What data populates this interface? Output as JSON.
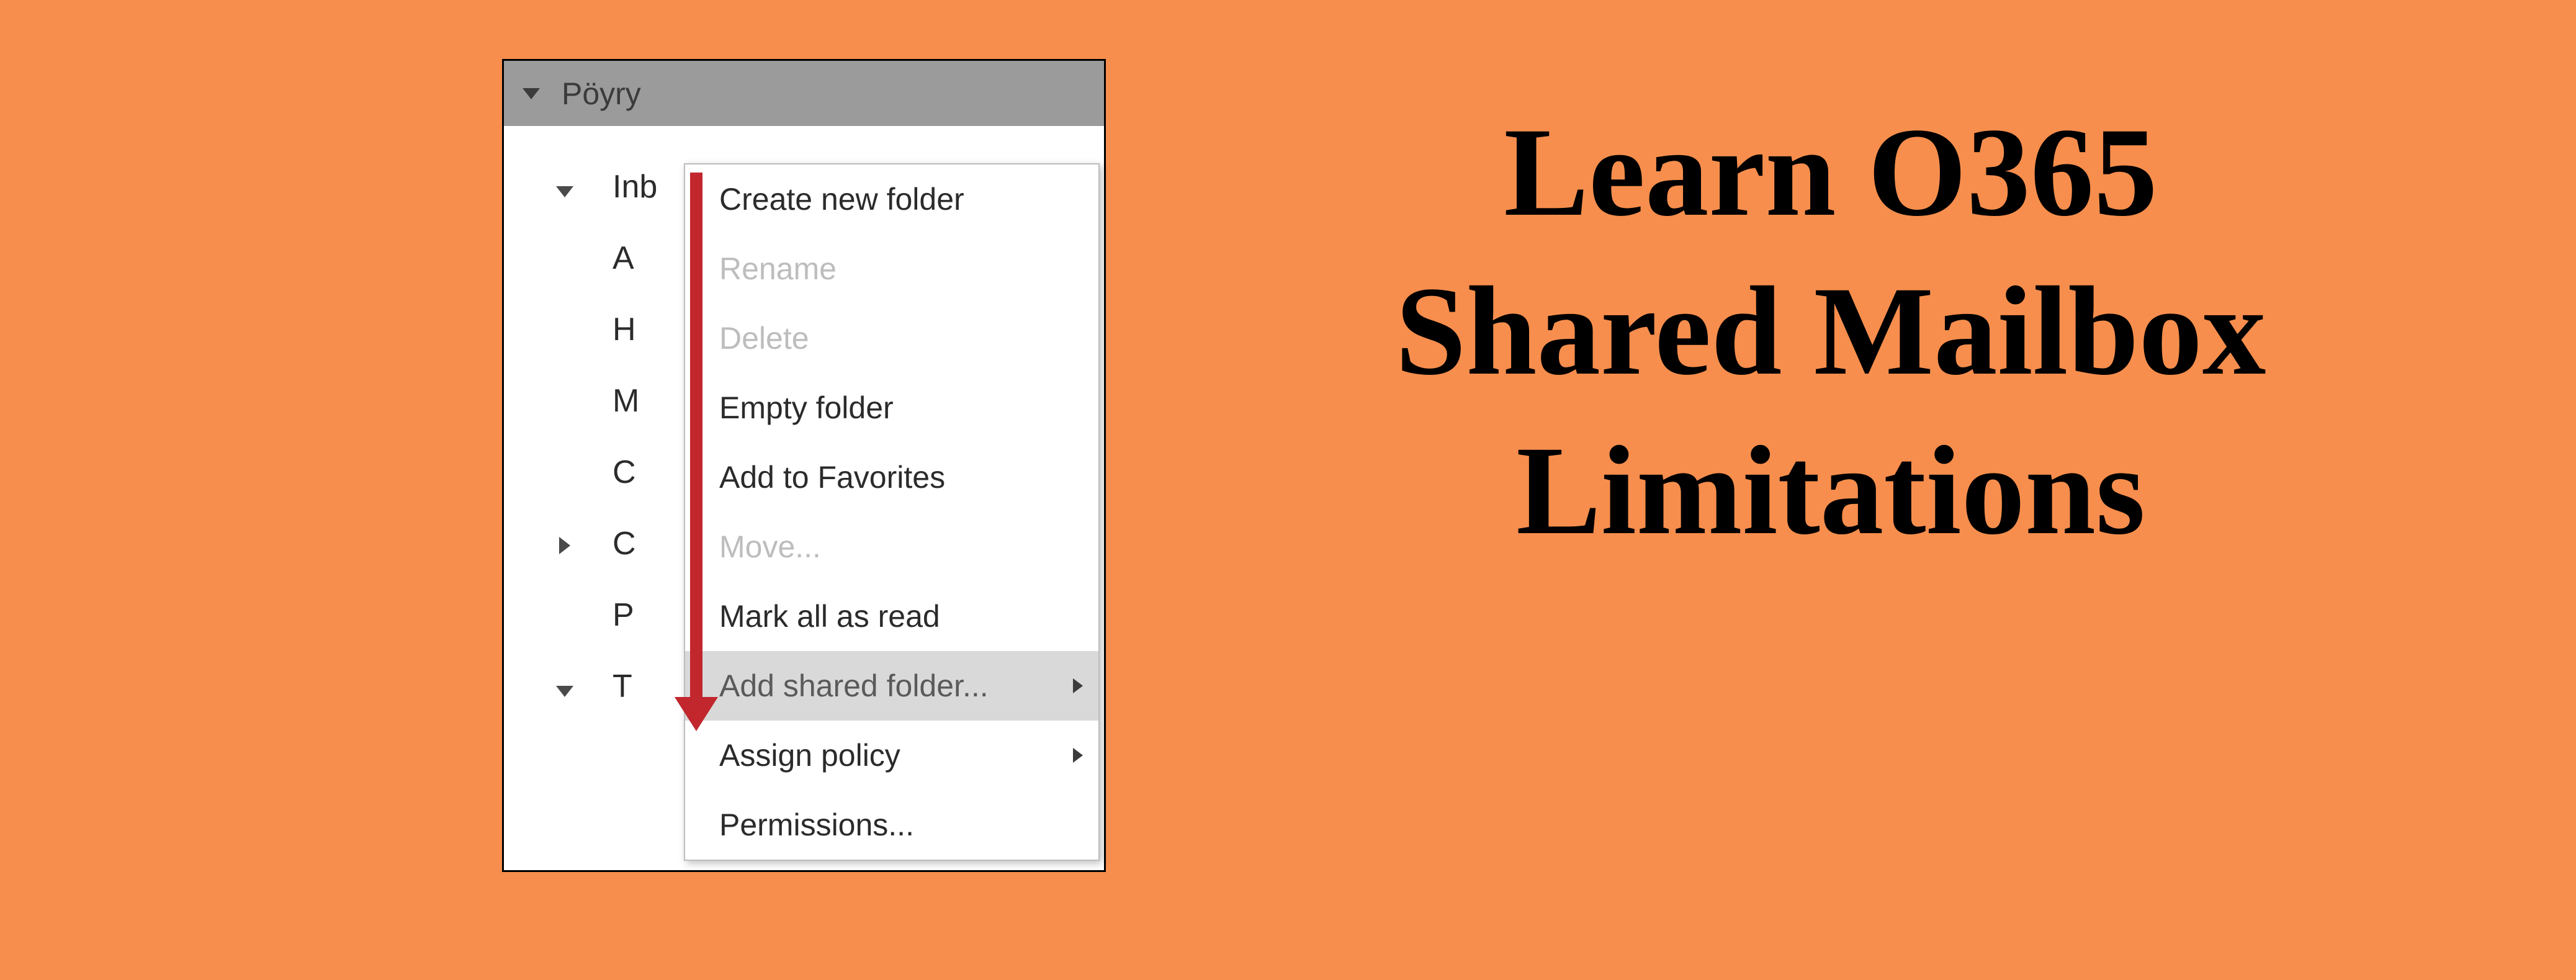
{
  "account": {
    "name": "Pöyry"
  },
  "tree": {
    "inbox": "Inb",
    "items": [
      "A",
      "H",
      "M",
      "C",
      "C",
      "P",
      "T"
    ]
  },
  "menu": {
    "create": "Create new folder",
    "rename": "Rename",
    "delete": "Delete",
    "empty": "Empty folder",
    "fav": "Add to Favorites",
    "move": "Move...",
    "markread": "Mark all as read",
    "addshared": "Add shared folder...",
    "assign": "Assign policy",
    "perm": "Permissions..."
  },
  "headline": {
    "l1": "Learn O365",
    "l2": "Shared Mailbox",
    "l3": "Limitations"
  }
}
